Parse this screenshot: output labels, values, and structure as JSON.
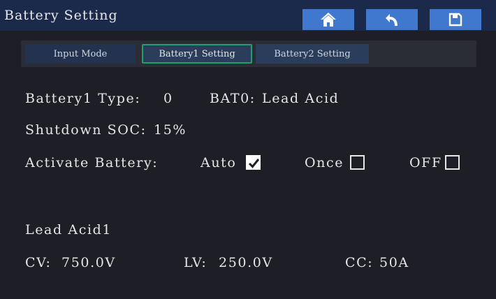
{
  "header": {
    "title": "Battery Setting",
    "buttons": [
      {
        "icon": "home-icon"
      },
      {
        "icon": "back-icon"
      },
      {
        "icon": "save-icon"
      }
    ],
    "accent": "#3f78cc"
  },
  "tabs": [
    {
      "label": "Input Mode",
      "active": false
    },
    {
      "label": "Battery1 Setting",
      "active": true
    },
    {
      "label": "Battery2 Setting",
      "active": false
    }
  ],
  "battery": {
    "type_label": "Battery1 Type:",
    "type_value": "0",
    "bat_label": "BAT0:",
    "bat_value": "Lead Acid",
    "shutdown_label": "Shutdown SOC:",
    "shutdown_value": "15%"
  },
  "activate": {
    "label": "Activate Battery:",
    "options": [
      {
        "label": "Auto",
        "checked": true
      },
      {
        "label": "Once",
        "checked": false
      },
      {
        "label": "OFF",
        "checked": false
      }
    ]
  },
  "lead_acid": {
    "title": "Lead Acid1",
    "cv_label": "CV:",
    "cv_value": "750.0V",
    "lv_label": "LV:",
    "lv_value": "250.0V",
    "cc_label": "CC:",
    "cc_value": "50A"
  }
}
